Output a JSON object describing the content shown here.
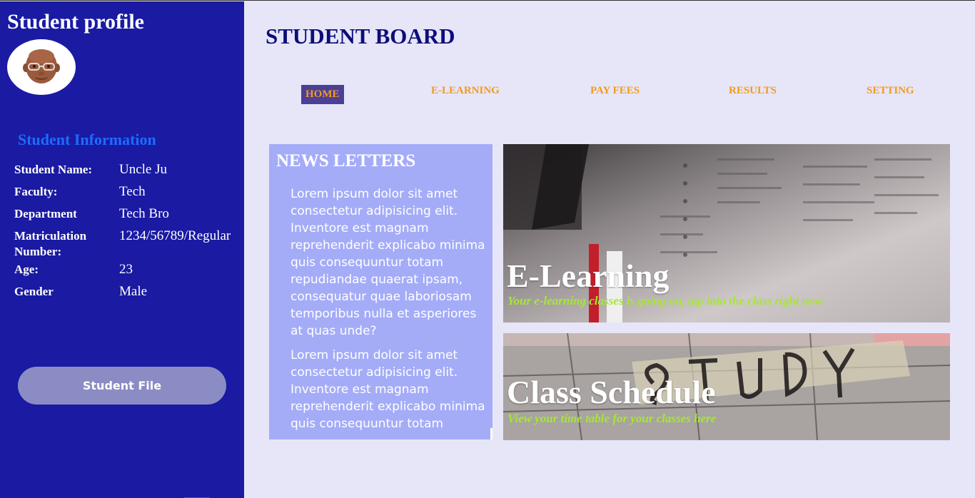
{
  "sidebar": {
    "title": "Student profile",
    "info_heading": "Student Information",
    "info": [
      {
        "label": "Student Name:",
        "value": "Uncle Ju"
      },
      {
        "label": "Faculty:",
        "value": "Tech"
      },
      {
        "label": "Department",
        "value": "Tech Bro"
      },
      {
        "label": "Matriculation Number:",
        "value": "1234/56789/Regular"
      },
      {
        "label": "Age:",
        "value": "23"
      },
      {
        "label": "Gender",
        "value": "Male"
      }
    ],
    "student_file_button": "Student File"
  },
  "header": {
    "title": "STUDENT BOARD"
  },
  "nav": {
    "items": [
      {
        "label": "HOME",
        "active": true
      },
      {
        "label": "E-LEARNING",
        "active": false
      },
      {
        "label": "PAY FEES",
        "active": false
      },
      {
        "label": "RESULTS",
        "active": false
      },
      {
        "label": "SETTING",
        "active": false
      }
    ]
  },
  "newsletter": {
    "title": "NEWS LETTERS",
    "paragraphs": [
      "Lorem ipsum dolor sit amet consectetur adipisicing elit. Inventore est magnam reprehenderit explicabo minima quis consequuntur totam repudiandae quaerat ipsam, consequatur quae laboriosam temporibus nulla et asperiores at quas unde?",
      "Lorem ipsum dolor sit amet consectetur adipisicing elit. Inventore est magnam reprehenderit explicabo minima quis consequuntur totam"
    ]
  },
  "cards": [
    {
      "title": "E-Learning",
      "subtitle": "Your e-learning classes is going on, tap into the class right now"
    },
    {
      "title": "Class Schedule",
      "subtitle": "View your time table for your classes here"
    }
  ],
  "colors": {
    "sidebar_bg": "#1a1aa3",
    "main_bg": "#e6e6f8",
    "accent_nav": "#f29a1f",
    "nav_active_bg": "#4b3f96",
    "info_heading": "#1f6bff",
    "newsletter_bg": "#a4acf8",
    "card_subtitle": "#a5e830"
  }
}
